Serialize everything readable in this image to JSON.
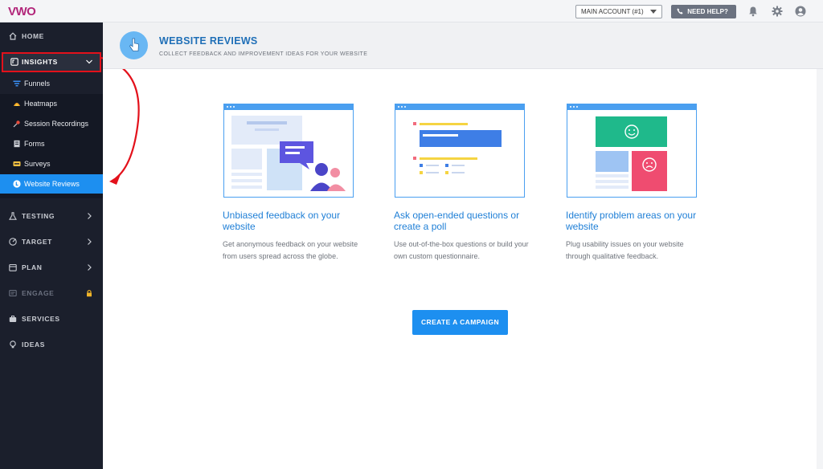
{
  "app": {
    "logo_text": "VWO",
    "account_select": "MAIN ACCOUNT (#1)",
    "help_button": "NEED HELP?",
    "icons": [
      "bell-icon",
      "gear-icon",
      "user-icon"
    ]
  },
  "sidebar": {
    "home": "HOME",
    "insights": "INSIGHTS",
    "sub_items": [
      {
        "label": "Funnels",
        "icon": "funnel-icon"
      },
      {
        "label": "Heatmaps",
        "icon": "heatmap-icon"
      },
      {
        "label": "Session Recordings",
        "icon": "recording-icon"
      },
      {
        "label": "Forms",
        "icon": "form-icon"
      },
      {
        "label": "Surveys",
        "icon": "survey-icon"
      },
      {
        "label": "Website Reviews",
        "icon": "review-icon",
        "active": true
      }
    ],
    "testing": "TESTING",
    "target": "TARGET",
    "plan": "PLAN",
    "engage": "ENGAGE",
    "services": "SERVICES",
    "ideas": "IDEAS"
  },
  "header": {
    "title": "WEBSITE REVIEWS",
    "subtitle": "COLLECT FEEDBACK AND IMPROVEMENT IDEAS FOR YOUR WEBSITE",
    "icon": "pointer-hand-icon"
  },
  "cards": [
    {
      "title": "Unbiased feedback on your website",
      "description": "Get anonymous feedback on your website from users spread across the globe."
    },
    {
      "title": "Ask open-ended questions or create a poll",
      "description": "Use out-of-the-box questions or build your own custom questionnaire."
    },
    {
      "title": "Identify problem areas on your website",
      "description": "Plug usability issues on your website through qualitative feedback."
    }
  ],
  "cta": "CREATE A CAMPAIGN",
  "colors": {
    "accent": "#1d8ff0",
    "sidebar_bg": "#1b1f2c",
    "annotation": "#e3111b",
    "brand": "#b2267a"
  }
}
